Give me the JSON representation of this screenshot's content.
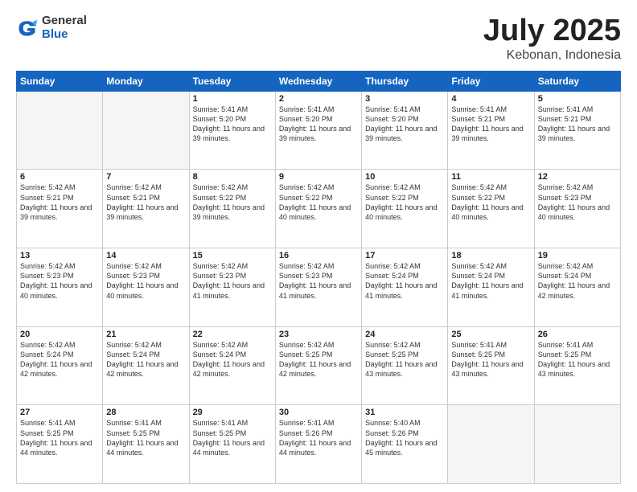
{
  "logo": {
    "general": "General",
    "blue": "Blue"
  },
  "header": {
    "month": "July 2025",
    "location": "Kebonan, Indonesia"
  },
  "days": [
    "Sunday",
    "Monday",
    "Tuesday",
    "Wednesday",
    "Thursday",
    "Friday",
    "Saturday"
  ],
  "weeks": [
    [
      {
        "day": null
      },
      {
        "day": null
      },
      {
        "day": 1,
        "sunrise": "5:41 AM",
        "sunset": "5:20 PM",
        "daylight": "11 hours and 39 minutes."
      },
      {
        "day": 2,
        "sunrise": "5:41 AM",
        "sunset": "5:20 PM",
        "daylight": "11 hours and 39 minutes."
      },
      {
        "day": 3,
        "sunrise": "5:41 AM",
        "sunset": "5:20 PM",
        "daylight": "11 hours and 39 minutes."
      },
      {
        "day": 4,
        "sunrise": "5:41 AM",
        "sunset": "5:21 PM",
        "daylight": "11 hours and 39 minutes."
      },
      {
        "day": 5,
        "sunrise": "5:41 AM",
        "sunset": "5:21 PM",
        "daylight": "11 hours and 39 minutes."
      }
    ],
    [
      {
        "day": 6,
        "sunrise": "5:42 AM",
        "sunset": "5:21 PM",
        "daylight": "11 hours and 39 minutes."
      },
      {
        "day": 7,
        "sunrise": "5:42 AM",
        "sunset": "5:21 PM",
        "daylight": "11 hours and 39 minutes."
      },
      {
        "day": 8,
        "sunrise": "5:42 AM",
        "sunset": "5:22 PM",
        "daylight": "11 hours and 39 minutes."
      },
      {
        "day": 9,
        "sunrise": "5:42 AM",
        "sunset": "5:22 PM",
        "daylight": "11 hours and 40 minutes."
      },
      {
        "day": 10,
        "sunrise": "5:42 AM",
        "sunset": "5:22 PM",
        "daylight": "11 hours and 40 minutes."
      },
      {
        "day": 11,
        "sunrise": "5:42 AM",
        "sunset": "5:22 PM",
        "daylight": "11 hours and 40 minutes."
      },
      {
        "day": 12,
        "sunrise": "5:42 AM",
        "sunset": "5:23 PM",
        "daylight": "11 hours and 40 minutes."
      }
    ],
    [
      {
        "day": 13,
        "sunrise": "5:42 AM",
        "sunset": "5:23 PM",
        "daylight": "11 hours and 40 minutes."
      },
      {
        "day": 14,
        "sunrise": "5:42 AM",
        "sunset": "5:23 PM",
        "daylight": "11 hours and 40 minutes."
      },
      {
        "day": 15,
        "sunrise": "5:42 AM",
        "sunset": "5:23 PM",
        "daylight": "11 hours and 41 minutes."
      },
      {
        "day": 16,
        "sunrise": "5:42 AM",
        "sunset": "5:23 PM",
        "daylight": "11 hours and 41 minutes."
      },
      {
        "day": 17,
        "sunrise": "5:42 AM",
        "sunset": "5:24 PM",
        "daylight": "11 hours and 41 minutes."
      },
      {
        "day": 18,
        "sunrise": "5:42 AM",
        "sunset": "5:24 PM",
        "daylight": "11 hours and 41 minutes."
      },
      {
        "day": 19,
        "sunrise": "5:42 AM",
        "sunset": "5:24 PM",
        "daylight": "11 hours and 42 minutes."
      }
    ],
    [
      {
        "day": 20,
        "sunrise": "5:42 AM",
        "sunset": "5:24 PM",
        "daylight": "11 hours and 42 minutes."
      },
      {
        "day": 21,
        "sunrise": "5:42 AM",
        "sunset": "5:24 PM",
        "daylight": "11 hours and 42 minutes."
      },
      {
        "day": 22,
        "sunrise": "5:42 AM",
        "sunset": "5:24 PM",
        "daylight": "11 hours and 42 minutes."
      },
      {
        "day": 23,
        "sunrise": "5:42 AM",
        "sunset": "5:25 PM",
        "daylight": "11 hours and 42 minutes."
      },
      {
        "day": 24,
        "sunrise": "5:42 AM",
        "sunset": "5:25 PM",
        "daylight": "11 hours and 43 minutes."
      },
      {
        "day": 25,
        "sunrise": "5:41 AM",
        "sunset": "5:25 PM",
        "daylight": "11 hours and 43 minutes."
      },
      {
        "day": 26,
        "sunrise": "5:41 AM",
        "sunset": "5:25 PM",
        "daylight": "11 hours and 43 minutes."
      }
    ],
    [
      {
        "day": 27,
        "sunrise": "5:41 AM",
        "sunset": "5:25 PM",
        "daylight": "11 hours and 44 minutes."
      },
      {
        "day": 28,
        "sunrise": "5:41 AM",
        "sunset": "5:25 PM",
        "daylight": "11 hours and 44 minutes."
      },
      {
        "day": 29,
        "sunrise": "5:41 AM",
        "sunset": "5:25 PM",
        "daylight": "11 hours and 44 minutes."
      },
      {
        "day": 30,
        "sunrise": "5:41 AM",
        "sunset": "5:26 PM",
        "daylight": "11 hours and 44 minutes."
      },
      {
        "day": 31,
        "sunrise": "5:40 AM",
        "sunset": "5:26 PM",
        "daylight": "11 hours and 45 minutes."
      },
      {
        "day": null
      },
      {
        "day": null
      }
    ]
  ]
}
